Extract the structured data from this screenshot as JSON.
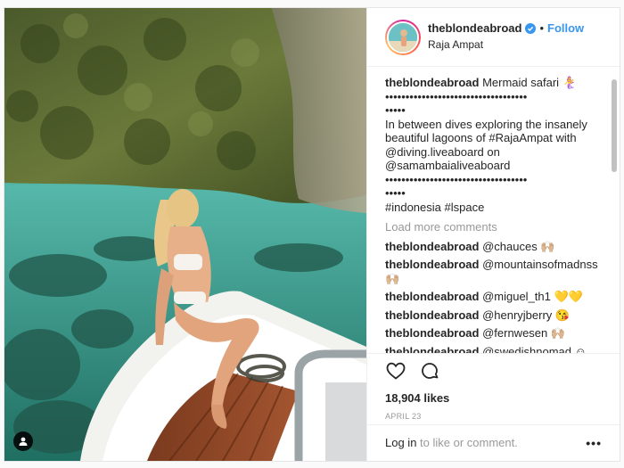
{
  "post": {
    "username": "theblondeabroad",
    "follow_label": "Follow",
    "dot": "•",
    "location": "Raja Ampat"
  },
  "caption": {
    "username": "theblondeabroad",
    "lines": [
      "Mermaid safari 🧜‍♀️",
      "•••••••••••••••••••••••••••••••••••",
      "•••••",
      "In between dives exploring the insanely",
      "beautiful lagoons of #RajaAmpat with",
      "@diving.liveaboard on",
      "@samambaialiveaboard",
      "•••••••••••••••••••••••••••••••••••",
      "•••••",
      "#indonesia #lspace"
    ]
  },
  "load_more": "Load more comments",
  "replies": [
    {
      "user": "theblondeabroad",
      "text": "@chauces 🙌🏼"
    },
    {
      "user": "theblondeabroad",
      "text": "@mountainsofmadnss"
    },
    {
      "user": "",
      "text": "🙌🏼"
    },
    {
      "user": "theblondeabroad",
      "text": "@miguel_th1 💛💛"
    },
    {
      "user": "theblondeabroad",
      "text": "@henryjberry 😘"
    },
    {
      "user": "theblondeabroad",
      "text": "@fernwesen 🙌🏼"
    },
    {
      "user": "theblondeabroad",
      "text": "@swedishnomad ☺"
    }
  ],
  "likes": "18,904 likes",
  "date": "APRIL 23",
  "add_comment": {
    "login": "Log in",
    "rest": " to like or comment.",
    "more": "•••"
  },
  "icons": [
    "heart-icon",
    "comment-icon",
    "tagged-user-icon",
    "verified-icon",
    "more-options-icon"
  ],
  "colors": {
    "link": "#3897f0",
    "muted": "#999999",
    "text": "#262626"
  }
}
